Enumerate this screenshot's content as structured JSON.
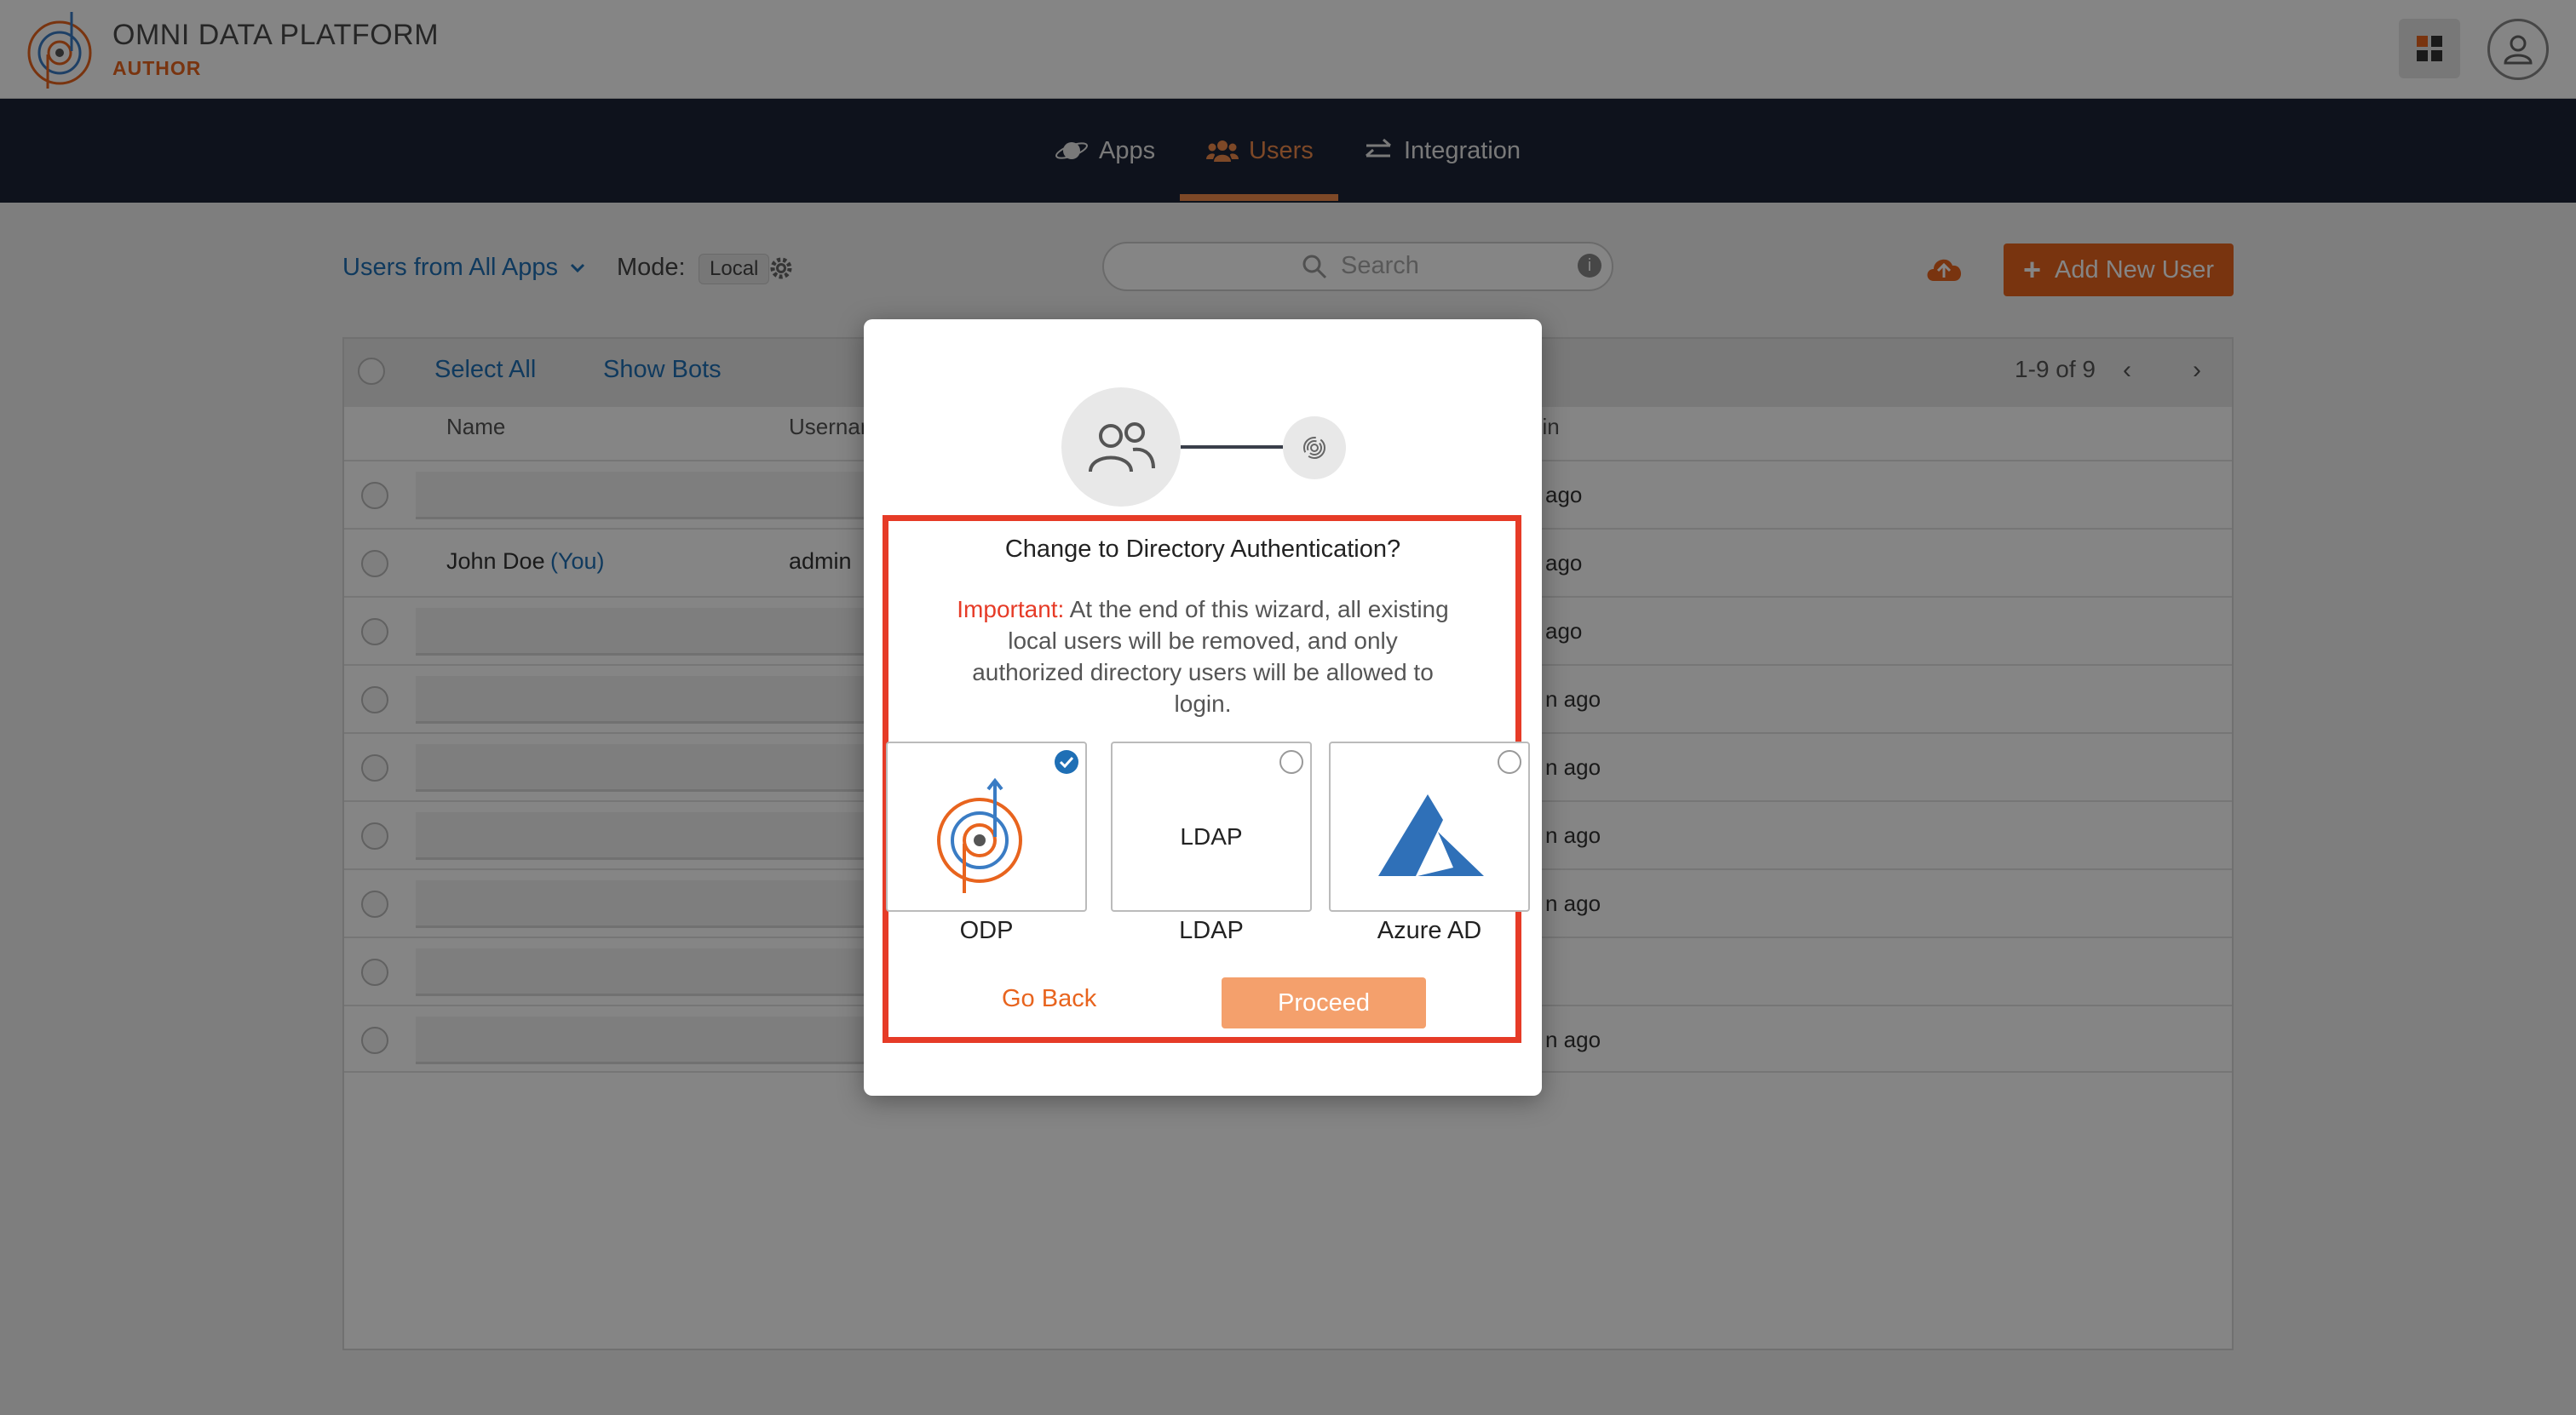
{
  "header": {
    "title": "OMNI DATA PLATFORM",
    "subtitle": "AUTHOR",
    "icons": {
      "logo": "odp-logo",
      "apps": "grid-icon",
      "profile": "user-icon"
    }
  },
  "nav": {
    "items": [
      {
        "label": "Apps",
        "icon": "planet-icon",
        "active": false
      },
      {
        "label": "Users",
        "icon": "users-icon",
        "active": true
      },
      {
        "label": "Integration",
        "icon": "swap-arrows-icon",
        "active": false
      }
    ]
  },
  "toolbar": {
    "users_filter": "Users from All Apps",
    "mode_label": "Mode:",
    "mode_value": "Local",
    "search_placeholder": "Search",
    "add_user": "Add New User"
  },
  "table": {
    "select_all": "Select All",
    "show_bots": "Show Bots",
    "pagination": "1-9 of 9",
    "columns": {
      "name": "Name",
      "username": "Usernar",
      "last": "gin"
    },
    "rows": [
      {
        "name": "",
        "you": "",
        "username": "",
        "time": "ago"
      },
      {
        "name": "John Doe",
        "you": "(You)",
        "username": "admin",
        "time": "ago"
      },
      {
        "name": "",
        "you": "",
        "username": "",
        "time": "ago"
      },
      {
        "name": "",
        "you": "",
        "username": "",
        "time": "n ago"
      },
      {
        "name": "",
        "you": "",
        "username": "",
        "time": "n ago"
      },
      {
        "name": "",
        "you": "",
        "username": "",
        "time": "n ago"
      },
      {
        "name": "",
        "you": "",
        "username": "",
        "time": "n ago"
      },
      {
        "name": "",
        "you": "",
        "username": "",
        "time": ""
      },
      {
        "name": "",
        "you": "",
        "username": "",
        "time": "n ago"
      }
    ]
  },
  "modal": {
    "title": "Change to Directory Authentication?",
    "important_label": "Important:",
    "body": "At the end of this wizard, all existing local users will be removed, and only authorized directory users will be allowed to login.",
    "options": [
      {
        "label": "ODP",
        "inner": "",
        "selected": true,
        "icon": "odp-logo"
      },
      {
        "label": "LDAP",
        "inner": "LDAP",
        "selected": false,
        "icon": ""
      },
      {
        "label": "Azure AD",
        "inner": "",
        "selected": false,
        "icon": "azure-logo"
      }
    ],
    "go_back": "Go Back",
    "proceed": "Proceed"
  },
  "colors": {
    "accent": "#e8641e",
    "nav_bg": "#1c2436",
    "link": "#1f6fb5",
    "highlight": "#e63b27"
  }
}
